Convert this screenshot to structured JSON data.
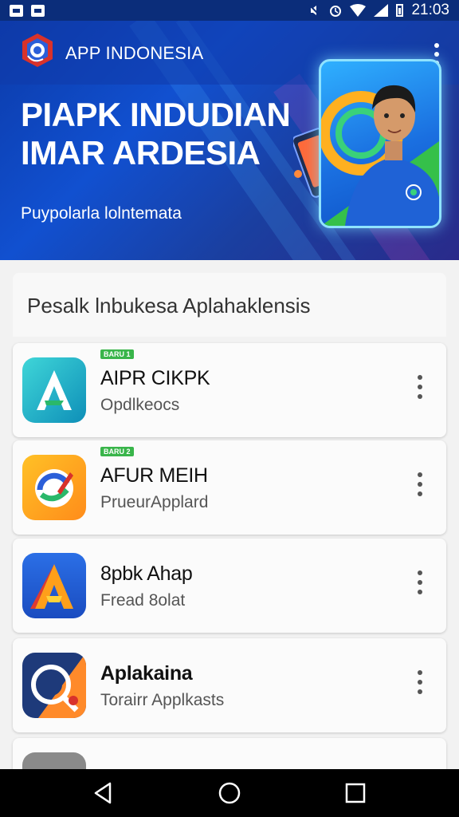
{
  "status_bar": {
    "time": "21:03",
    "left_icons": [
      "gallery-notification-icon",
      "image-notification-icon"
    ],
    "right_icons": [
      "mute-icon",
      "alarm-icon",
      "wifi-icon",
      "signal-icon",
      "battery-icon"
    ]
  },
  "app_bar": {
    "title": "APP INDONESIA",
    "menu_icon": "more-vert-icon"
  },
  "hero": {
    "heading_line1": "PIAPK INDUDIAN",
    "heading_line2": "IMAR ARDESIA",
    "subtitle": "Puypolarla lolntemata"
  },
  "section": {
    "title": "Pesalk lnbukesa Aplahaklensis"
  },
  "apps": [
    {
      "badge": "BARU 1",
      "name": "AIPR CIKPK",
      "desc": "Opdlkeocs",
      "icon": "aipr-app-icon"
    },
    {
      "badge": "BARU 2",
      "name": "AFUR MEIH",
      "desc": "PrueurApplard",
      "icon": "afur-app-icon"
    },
    {
      "badge": "",
      "name": "8pbk Ahap",
      "desc": "Fread 8olat",
      "icon": "spbk-app-icon"
    },
    {
      "badge": "",
      "name": "Aplakaina",
      "desc": "Torairr Applkasts",
      "icon": "aplakaina-app-icon"
    }
  ],
  "colors": {
    "hero_blue": "#1150d0",
    "badge_green": "#39b54a",
    "status_bar": "#0b2d7a"
  },
  "nav": {
    "back_icon": "back-triangle-icon",
    "home_icon": "home-circle-icon",
    "recents_icon": "recents-square-icon"
  }
}
